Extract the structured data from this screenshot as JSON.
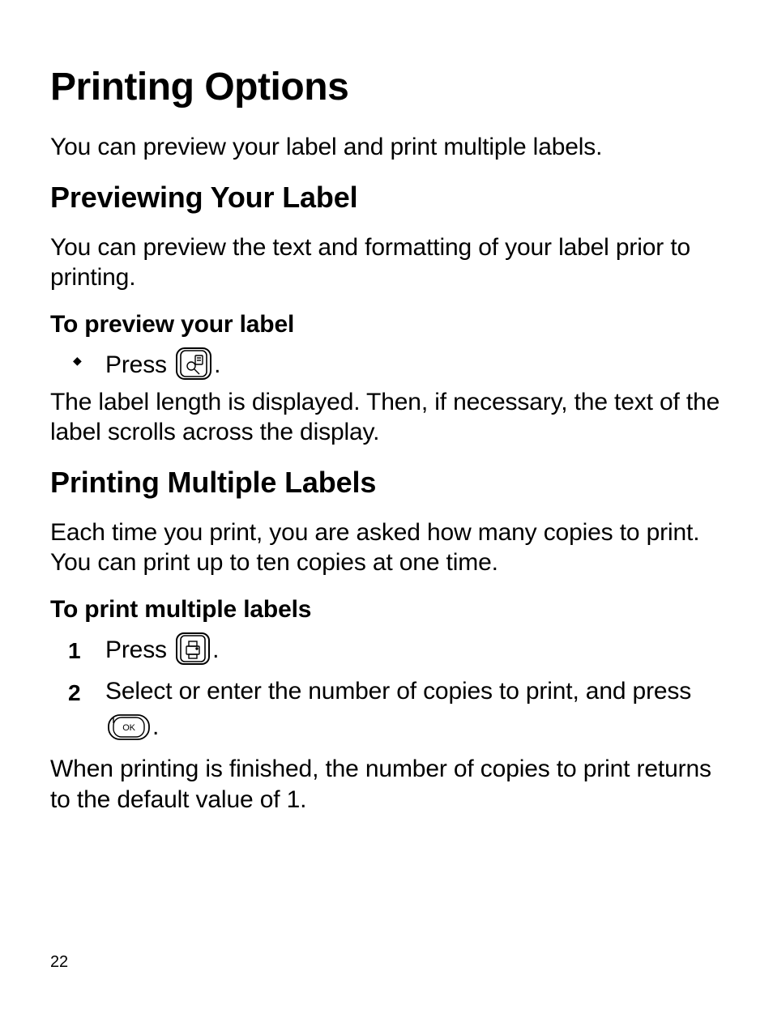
{
  "page_number": "22",
  "h1": "Printing Options",
  "intro": "You can preview your label and print multiple labels.",
  "sec1": {
    "title": "Previewing Your Label",
    "body": "You can preview the text and formatting of your label prior to printing.",
    "proc_title": "To preview your label",
    "step1_pre": "Press ",
    "step1_post": ".",
    "after": "The label length is displayed. Then, if necessary, the text of the label scrolls across the display."
  },
  "sec2": {
    "title": "Printing Multiple Labels",
    "body": "Each time you print, you are asked how many copies to print. You can print up to ten copies at one time.",
    "proc_title": "To print multiple labels",
    "step1_pre": "Press ",
    "step1_post": ".",
    "step2_pre": "Select or enter the number of copies to print, and press ",
    "step2_post": ".",
    "after": "When printing is finished, the number of copies to print returns to the default value of 1."
  },
  "icons": {
    "preview_key": "preview-key-icon",
    "print_key": "print-key-icon",
    "ok_key": "ok-key-icon"
  }
}
